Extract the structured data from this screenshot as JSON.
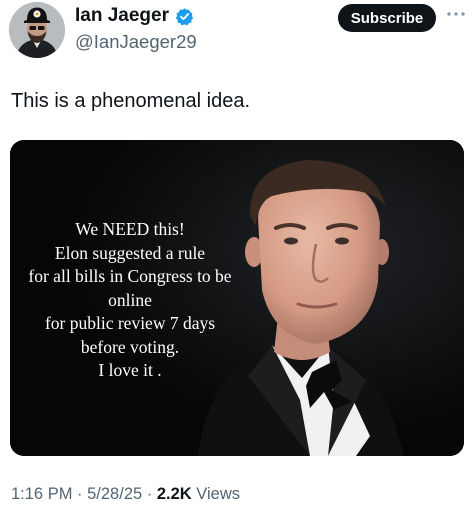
{
  "author": {
    "name": "Ian Jaeger",
    "handle": "@IanJaeger29",
    "verified": true,
    "avatar_icon": "avatar"
  },
  "actions": {
    "subscribe_label": "Subscribe",
    "more_icon": "more-horizontal-icon"
  },
  "tweet": {
    "text": "This is a phenomenal idea."
  },
  "media": {
    "overlay_lines": [
      "We NEED this!",
      "Elon suggested a rule",
      "for all bills in Congress to be",
      "online",
      "for public review 7 days",
      "before voting.",
      "I love it ."
    ]
  },
  "meta": {
    "time": "1:16 PM",
    "date": "5/28/25",
    "sep": " · ",
    "views_count": "2.2K",
    "views_label": " Views"
  },
  "colors": {
    "text": "#0f1419",
    "secondary": "#536471",
    "verified_blue": "#1d9bf0",
    "button_bg": "#0f1419"
  }
}
